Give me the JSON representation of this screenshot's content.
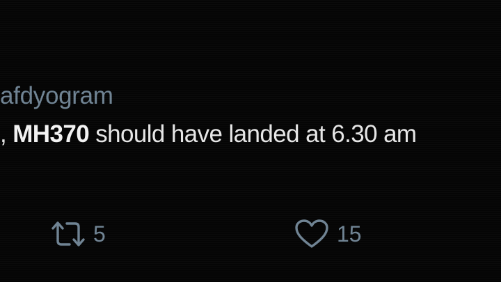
{
  "tweet": {
    "handle_fragment": "afdyogram",
    "text_prefix": ", ",
    "mention": "MH370",
    "text_rest": " should have landed at 6.30 am"
  },
  "actions": {
    "retweet": {
      "icon": "retweet-icon",
      "count": "5"
    },
    "like": {
      "icon": "heart-icon",
      "count": "15"
    }
  },
  "colors": {
    "background": "#050505",
    "text": "#e6e6e6",
    "muted": "#6f8393"
  }
}
